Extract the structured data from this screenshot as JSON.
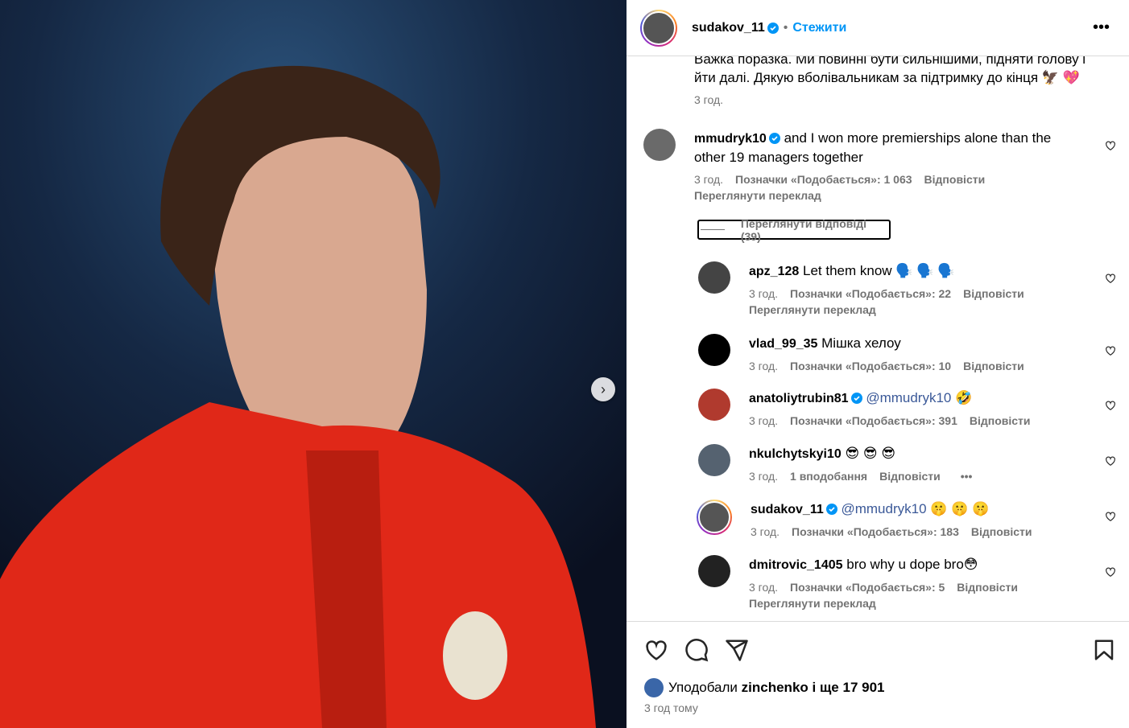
{
  "header": {
    "username": "sudakov_11",
    "follow": "Стежити"
  },
  "caption": {
    "line1": "Важка поразка. Ми повинні бути сильнішими, підняти голову і",
    "line2": "йти далі. Дякую вболівальникам за підтримку до кінця 🦅 💖",
    "time": "3 год."
  },
  "comment_main": {
    "user": "mmudryk10",
    "text1": "and I won more premierships alone than the",
    "text2": "other 19 managers together",
    "time": "3 год.",
    "likes": "Позначки «Подобається»: 1 063",
    "reply": "Відповісти",
    "translate": "Переглянути переклад",
    "view_replies": "Переглянути відповіді (39)"
  },
  "replies": [
    {
      "user": "apz_128",
      "verified": false,
      "text": "Let them know 🗣️ 🗣️ 🗣️",
      "time": "3 год.",
      "likes": "Позначки «Подобається»: 22",
      "reply": "Відповісти",
      "translate": "Переглянути переклад"
    },
    {
      "user": "vlad_99_35",
      "verified": false,
      "text": "Мішка хелоу",
      "time": "3 год.",
      "likes": "Позначки «Подобається»: 10",
      "reply": "Відповісти",
      "translate": ""
    },
    {
      "user": "anatoliytrubin81",
      "verified": true,
      "mention": "@mmudryk10",
      "text": "🤣",
      "time": "3 год.",
      "likes": "Позначки «Подобається»: 391",
      "reply": "Відповісти",
      "translate": ""
    },
    {
      "user": "nkulchytskyi10",
      "verified": false,
      "text": "😎 😎 😎",
      "time": "3 год.",
      "likes": "1 вподобання",
      "reply": "Відповісти",
      "more": "•••",
      "translate": ""
    },
    {
      "user": "sudakov_11",
      "verified": true,
      "mention": "@mmudryk10",
      "text": "🤫 🤫 🤫",
      "time": "3 год.",
      "likes": "Позначки «Подобається»: 183",
      "reply": "Відповісти",
      "translate": ""
    },
    {
      "user": "dmitrovic_1405",
      "verified": false,
      "text": "bro why u dope bro😳",
      "time": "3 год.",
      "likes": "Позначки «Подобається»: 5",
      "reply": "Відповісти",
      "translate": "Переглянути переклад"
    }
  ],
  "likes": {
    "prefix": "Уподобали",
    "user": "zinchenko",
    "suffix": "і ще 17 901"
  },
  "post_time": "3 год тому"
}
